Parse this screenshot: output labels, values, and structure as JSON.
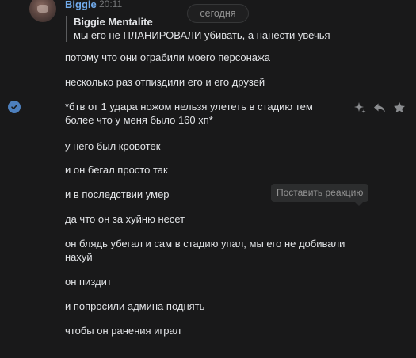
{
  "header": {
    "author": "Biggie",
    "time": "20:11",
    "date_divider": "сегодня"
  },
  "reply": {
    "author": "Biggie Mentalite",
    "text": "мы его не ПЛАНИРОВАЛИ убивать, а нанести увечья"
  },
  "messages": [
    "потому что они ограбили моего персонажа",
    "несколько раз отпиздили его и его друзей",
    "*бтв от 1 удара ножом нельзя улететь в стадию тем более что у меня было 160 хп*",
    "у него был кровотек",
    "и он бегал просто так",
    "и в последствии умер",
    "да что он за хуйню несет",
    "он блядь убегал и сам в стадию упал, мы его не добивали нахуй",
    "он пиздит",
    "и попросили админа поднять",
    "чтобы он ранения играл"
  ],
  "tooltip": "Поставить реакцию",
  "icons": {
    "selected": "check-circle-icon",
    "reaction": "sparkle-icon",
    "reply": "reply-arrow-icon",
    "favorite": "star-icon"
  },
  "colors": {
    "background": "#19191a",
    "author_link": "#71aaeb",
    "text": "#e1e3e6",
    "muted": "#939393",
    "check": "#4d7fbd"
  }
}
